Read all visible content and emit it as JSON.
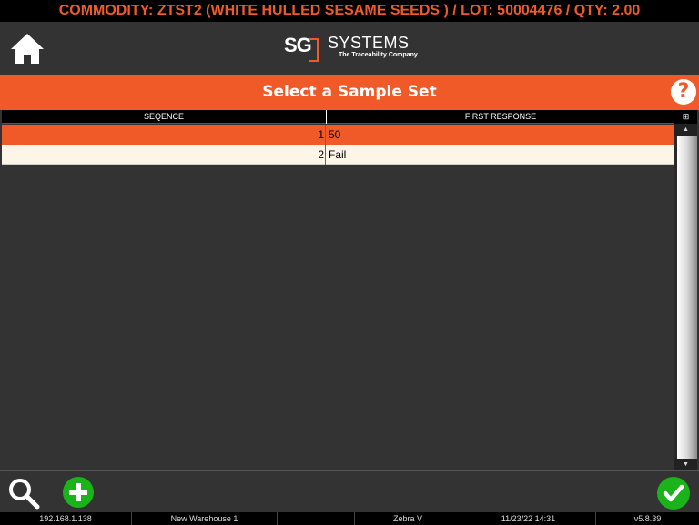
{
  "commodity_bar": "COMMODITY: ZTST2 (WHITE HULLED SESAME SEEDS ) / LOT: 50004476 / QTY: 2.00",
  "header": {
    "home_icon": "home-icon",
    "logo": {
      "sg": "SG",
      "systems": "SYSTEMS",
      "tagline": "The Traceability Company"
    }
  },
  "title_bar": {
    "title": "Select a Sample Set",
    "help_label": "?"
  },
  "grid": {
    "columns": [
      "SEQENCE",
      "FIRST RESPONSE"
    ],
    "rows": [
      {
        "seq": "1",
        "first": "50",
        "selected": true
      },
      {
        "seq": "2",
        "first": "Fail",
        "selected": false
      }
    ]
  },
  "scrollbar": {
    "corner_glyph": "⊞",
    "up_glyph": "▲",
    "down_glyph": "▼"
  },
  "footer": {
    "search_icon": "search-icon",
    "add_icon": "plus-icon",
    "confirm_icon": "checkmark-icon"
  },
  "status_bar": {
    "ip": "192.168.1.138",
    "warehouse": "New Warehouse 1",
    "blank": "",
    "printer": "Zebra V",
    "datetime": "11/23/22 14:31",
    "version": "v5.8.39"
  },
  "colors": {
    "accent": "#f05a28",
    "green": "#1ab31a",
    "background": "#333333"
  }
}
